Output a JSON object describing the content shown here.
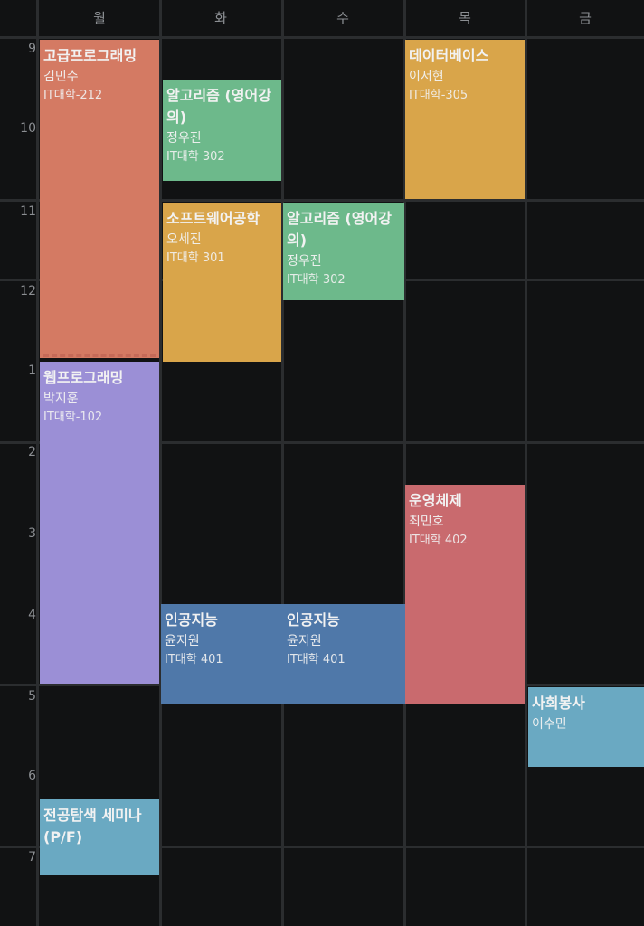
{
  "days": [
    "월",
    "화",
    "수",
    "목",
    "금"
  ],
  "hours": [
    "9",
    "10",
    "11",
    "12",
    "1",
    "2",
    "3",
    "4",
    "5",
    "6",
    "7"
  ],
  "events": [
    {
      "title": "고급프로그래밍",
      "prof": "김민수",
      "room": "IT대학-212"
    },
    {
      "title": "알고리즘 (영어강의)",
      "prof": "정우진",
      "room": "IT대학 302"
    },
    {
      "title": "소프트웨어공학",
      "prof": "오세진",
      "room": "IT대학 301"
    },
    {
      "title": "알고리즘 (영어강의)",
      "prof": "정우진",
      "room": "IT대학 302"
    },
    {
      "title": "데이터베이스",
      "prof": "이서현",
      "room": "IT대학-305"
    },
    {
      "title": "웹프로그래밍",
      "prof": "박지훈",
      "room": "IT대학-102"
    },
    {
      "title": "운영체제",
      "prof": "최민호",
      "room": "IT대학 402"
    },
    {
      "title": "인공지능",
      "prof": "윤지원",
      "room": "IT대학 401"
    },
    {
      "title": "인공지능",
      "prof": "윤지원",
      "room": "IT대학 401"
    },
    {
      "title": "사회봉사",
      "prof": "이수민",
      "room": ""
    },
    {
      "title": "전공탐색 세미나 (P/F)",
      "prof": "",
      "room": ""
    }
  ]
}
